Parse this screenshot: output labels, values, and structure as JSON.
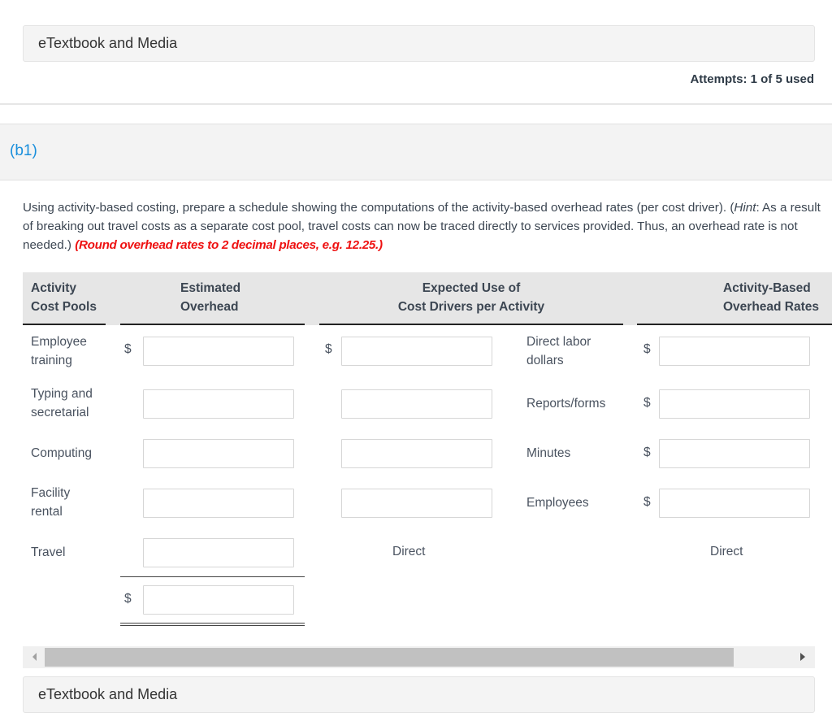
{
  "media_top": {
    "label": "eTextbook and Media"
  },
  "attempts": "Attempts: 1 of 5 used",
  "part": {
    "label": "(b1)"
  },
  "instructions": {
    "main": "Using activity-based costing, prepare a schedule showing the computations of the activity-based overhead rates (per cost driver). (",
    "hint_word": "Hint",
    "hint_rest": ": As a result of breaking out travel costs as a separate cost pool, travel costs can now be traced directly to services provided. Thus, an overhead rate is not needed.) ",
    "rounding": "(Round overhead rates to 2 decimal places, e.g. 12.25.)"
  },
  "table": {
    "headers": {
      "col1": [
        "Activity",
        "Cost Pools"
      ],
      "col2": [
        "Estimated",
        "Overhead"
      ],
      "col3": [
        "Expected Use of",
        "Cost Drivers per Activity"
      ],
      "col4": [
        "Activity-Based",
        "Overhead Rates"
      ]
    },
    "currency_symbol": "$",
    "rows": [
      {
        "pool": [
          "Employee",
          "training"
        ],
        "overhead": "",
        "driver_qty": "",
        "driver": [
          "Direct labor",
          "dollars"
        ],
        "rate": ""
      },
      {
        "pool": [
          "Typing and",
          "secretarial"
        ],
        "overhead": "",
        "driver_qty": "",
        "driver": [
          "Reports/forms"
        ],
        "rate": ""
      },
      {
        "pool": [
          "Computing"
        ],
        "overhead": "",
        "driver_qty": "",
        "driver": [
          "Minutes"
        ],
        "rate": ""
      },
      {
        "pool": [
          "Facility",
          "rental"
        ],
        "overhead": "",
        "driver_qty": "",
        "driver": [
          "Employees"
        ],
        "rate": ""
      },
      {
        "pool": [
          "Travel"
        ],
        "overhead": "",
        "driver_text": "Direct",
        "rate_text": "Direct"
      }
    ],
    "total": {
      "overhead": ""
    }
  },
  "media_bottom": {
    "label": "eTextbook and Media"
  }
}
